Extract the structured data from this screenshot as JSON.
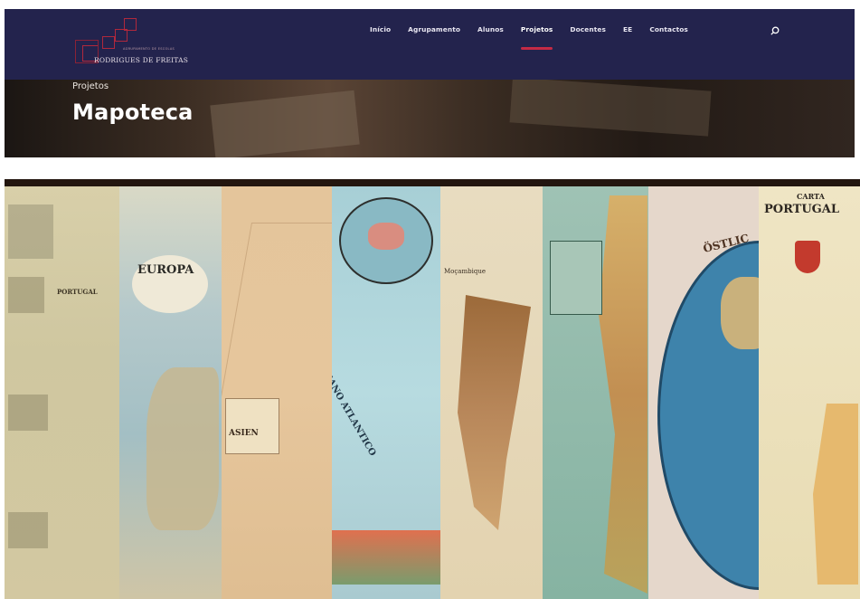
{
  "logo": {
    "text": "RODRIGUES DE FREITAS",
    "subtext": "AGRUPAMENTO DE ESCOLAS"
  },
  "nav": {
    "items": [
      {
        "label": "Início"
      },
      {
        "label": "Agrupamento"
      },
      {
        "label": "Alunos"
      },
      {
        "label": "Projetos",
        "active": true
      },
      {
        "label": "Docentes"
      },
      {
        "label": "EE"
      },
      {
        "label": "Contactos"
      }
    ],
    "search_icon": "search-icon"
  },
  "hero": {
    "breadcrumb": "Projetos",
    "title": "Mapoteca"
  },
  "maps": {
    "labels": {
      "portugal1": "PORTUGAL",
      "europa": "EUROPA",
      "asien": "ASIEN",
      "oceano": "OCEANO ATLANTICO",
      "mocambique": "Moçambique",
      "ostl": "ÖSTLIC",
      "carta": "CARTA",
      "carta_portugal": "PORTUGAL"
    }
  },
  "colors": {
    "navbar": "#23234d",
    "accent": "#c42a45"
  }
}
